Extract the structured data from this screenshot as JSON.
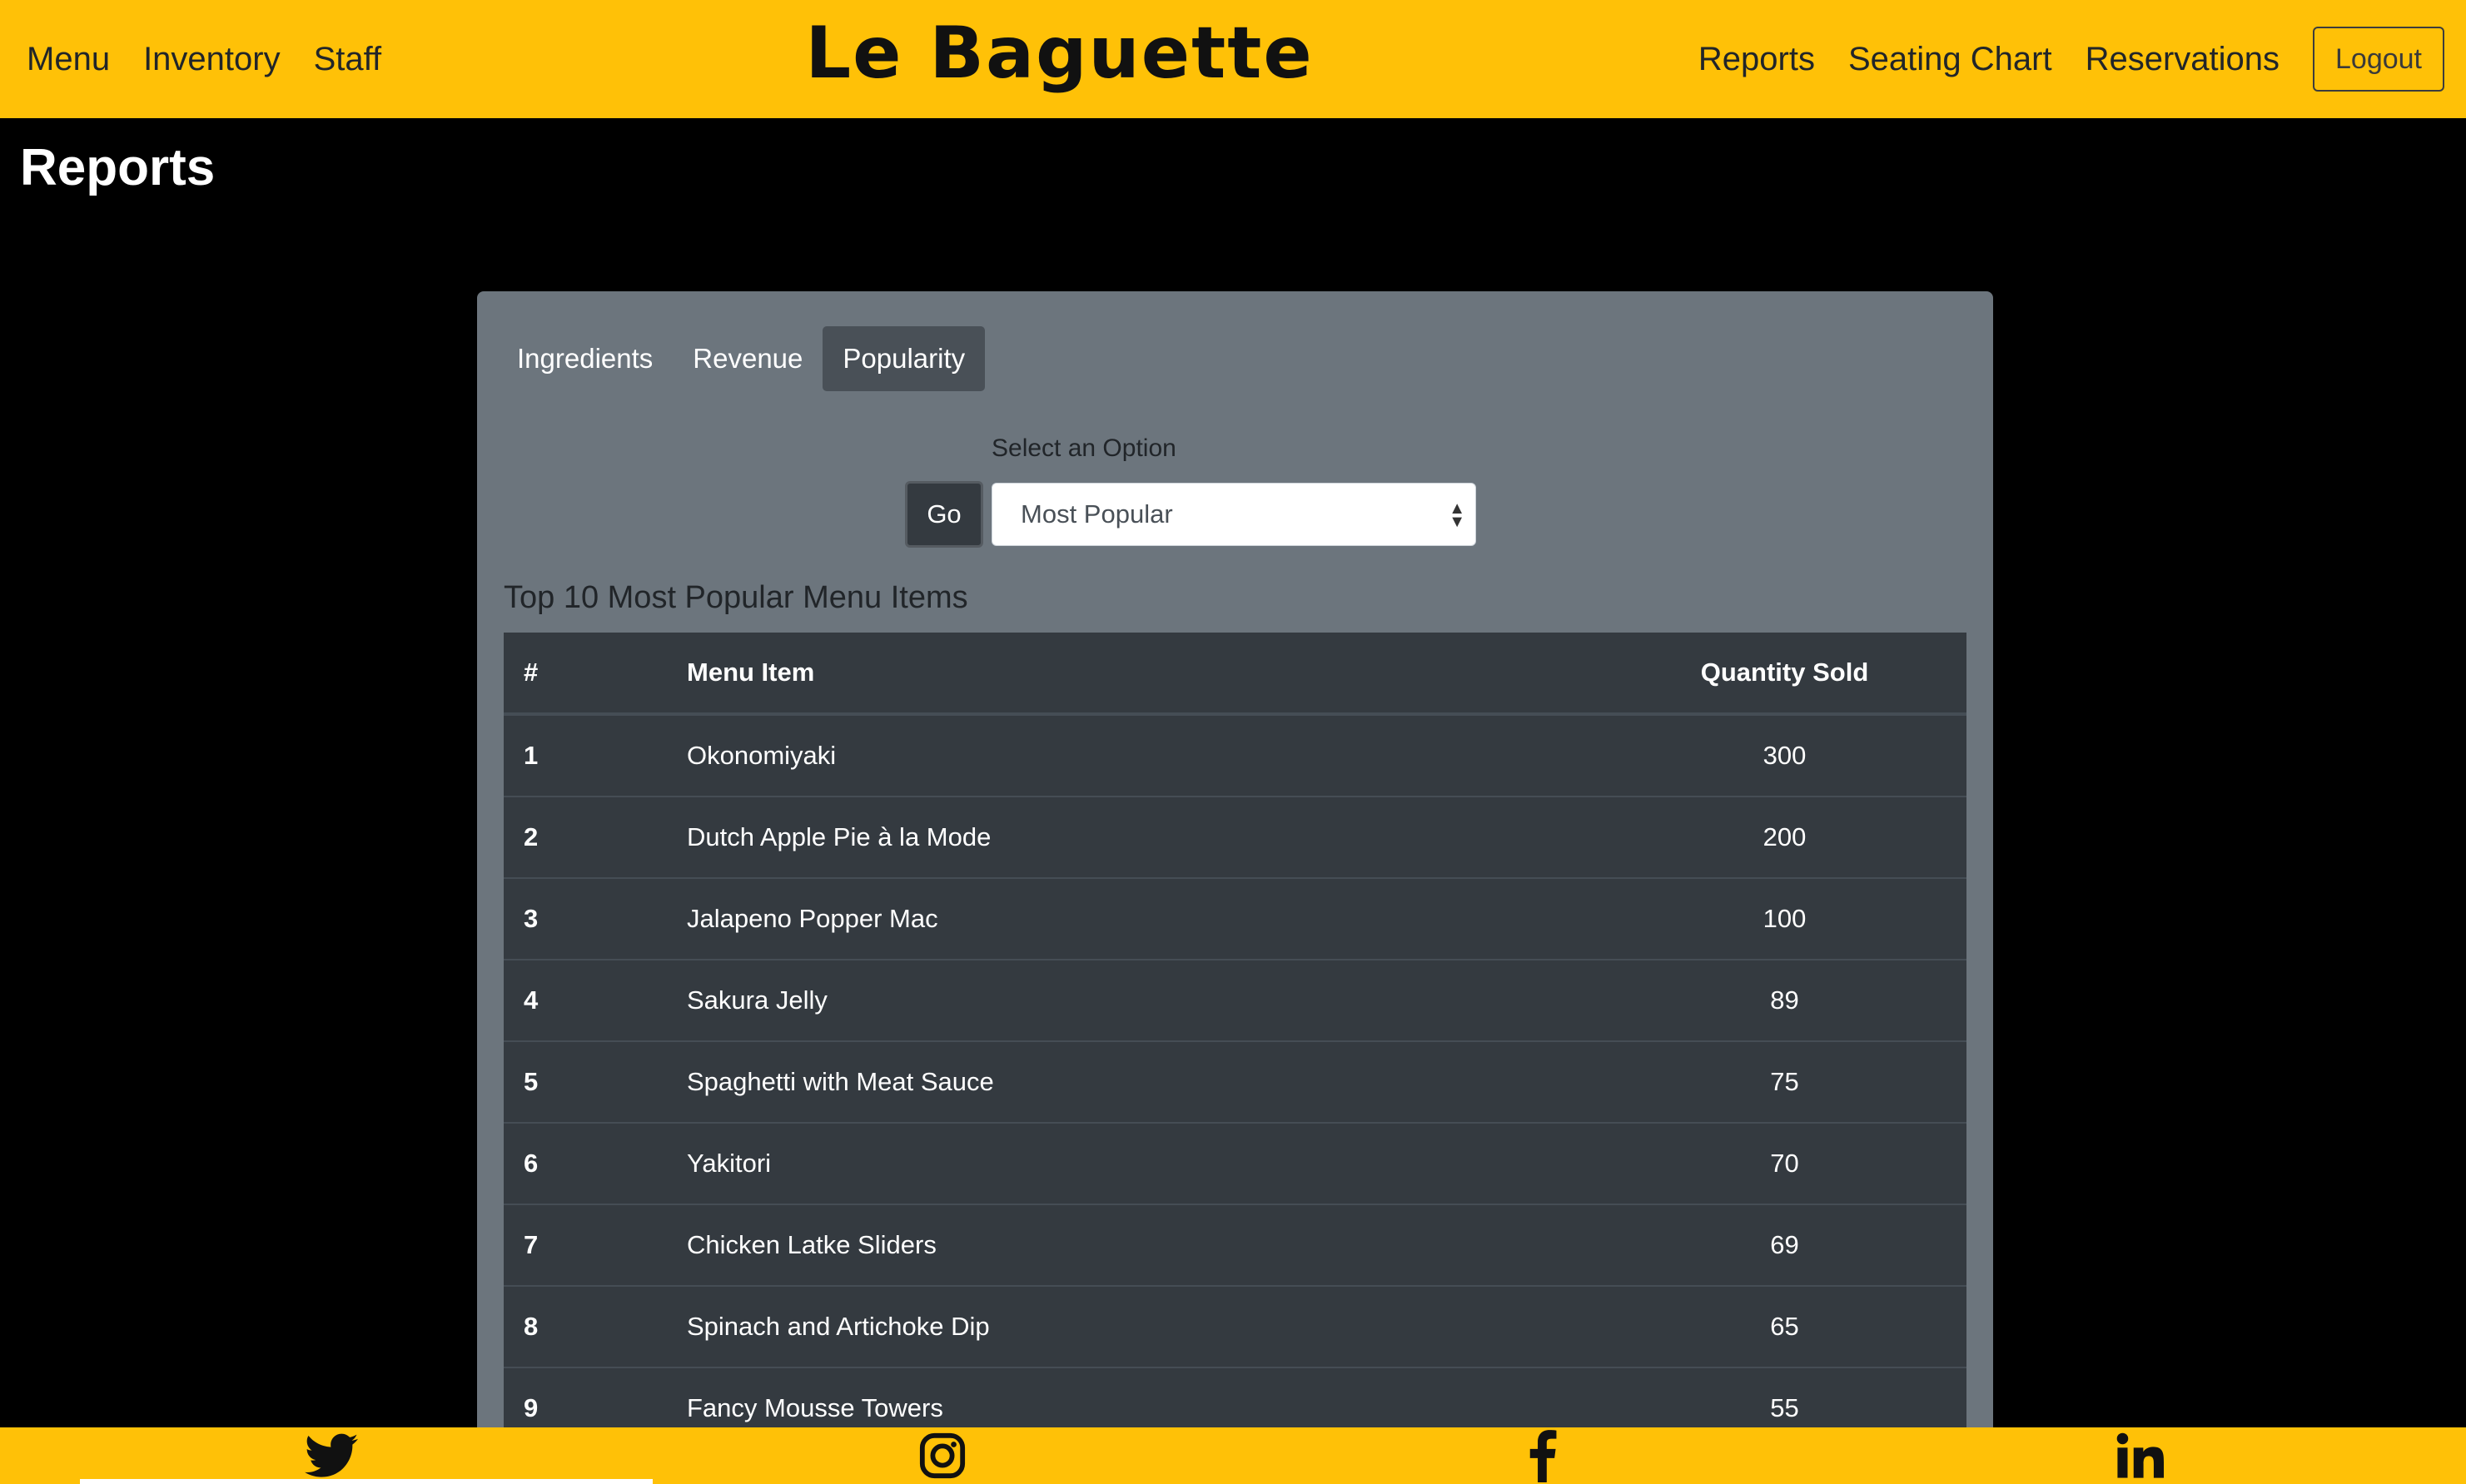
{
  "nav": {
    "brand": "Le Baguette",
    "left": [
      "Menu",
      "Inventory",
      "Staff"
    ],
    "right": [
      "Reports",
      "Seating Chart",
      "Reservations"
    ],
    "logout": "Logout"
  },
  "page": {
    "title": "Reports"
  },
  "tabs": [
    "Ingredients",
    "Revenue",
    "Popularity"
  ],
  "active_tab": "Popularity",
  "controls": {
    "select_label": "Select an Option",
    "go_label": "Go",
    "selected_option": "Most Popular"
  },
  "table": {
    "title": "Top 10 Most Popular Menu Items",
    "headers": [
      "#",
      "Menu Item",
      "Quantity Sold"
    ],
    "rows": [
      [
        "1",
        "Okonomiyaki",
        "300"
      ],
      [
        "2",
        "Dutch Apple Pie à la Mode",
        "200"
      ],
      [
        "3",
        "Jalapeno Popper Mac",
        "100"
      ],
      [
        "4",
        "Sakura Jelly",
        "89"
      ],
      [
        "5",
        "Spaghetti with Meat Sauce",
        "75"
      ],
      [
        "6",
        "Yakitori",
        "70"
      ],
      [
        "7",
        "Chicken Latke Sliders",
        "69"
      ],
      [
        "8",
        "Spinach and Artichoke Dip",
        "65"
      ],
      [
        "9",
        "Fancy Mousse Towers",
        "55"
      ]
    ]
  },
  "footer": {
    "icons": [
      "twitter-icon",
      "instagram-icon",
      "facebook-icon",
      "linkedin-icon"
    ]
  },
  "colors": {
    "accent": "#ffc107",
    "card": "#6c757d",
    "table": "#343a40"
  }
}
